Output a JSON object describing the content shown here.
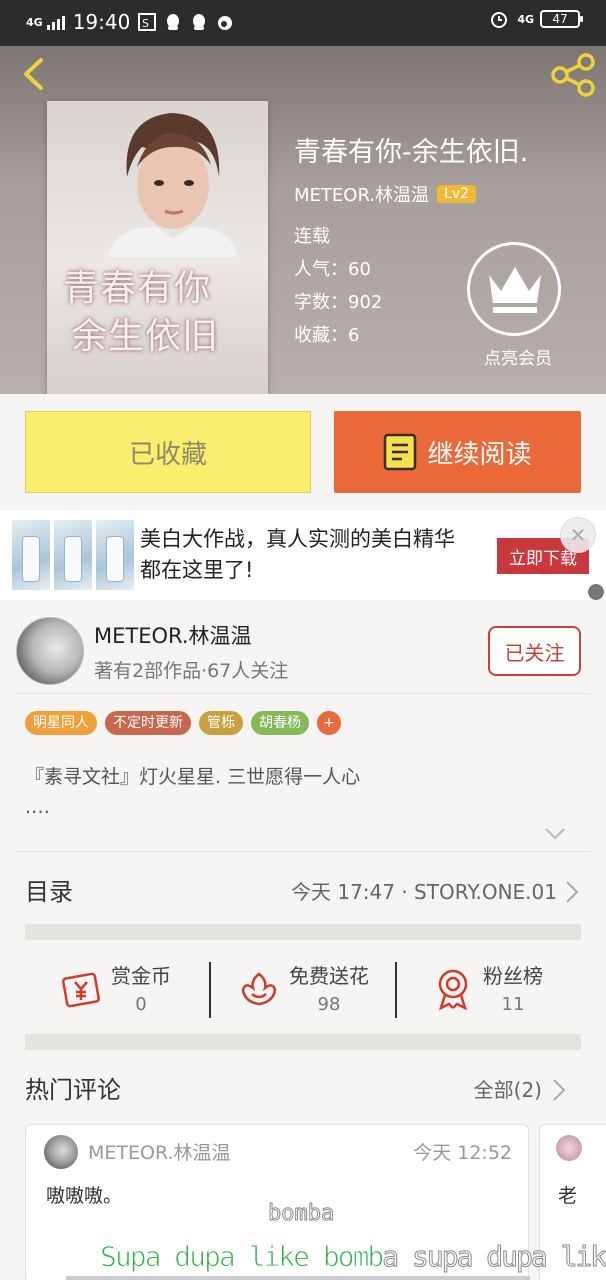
{
  "status_bar": {
    "network": "4G",
    "time": "19:40",
    "right_network": "4G",
    "battery": "47"
  },
  "book": {
    "title": "青春有你-余生依旧.",
    "author": "METEOR.林温温",
    "level": "Lv2",
    "status": "连载",
    "popularity": "人气：60",
    "word_count": "字数：902",
    "favorites": "收藏：6",
    "cover_title_line1": "青春有你",
    "cover_title_line2": "余生依旧",
    "membership_label": "点亮会员"
  },
  "actions": {
    "collected_label": "已收藏",
    "continue_label": "继续阅读"
  },
  "ad": {
    "text": "美白大作战，真人实测的美白精华都在这里了!",
    "button": "立即下载"
  },
  "author_card": {
    "name": "METEOR.林温温",
    "subtitle": "著有2部作品·67人关注",
    "follow_label": "已关注",
    "tags": [
      {
        "label": "明星同人",
        "color": "#f0a03a"
      },
      {
        "label": "不定时更新",
        "color": "#c8664e"
      },
      {
        "label": "管栎",
        "color": "#c9a03e"
      },
      {
        "label": "胡春杨",
        "color": "#86b85a"
      }
    ],
    "tag_plus": "+",
    "intro_line1": "『素寻文社』灯火星星. 三世愿得一人心",
    "intro_line2": ".…"
  },
  "toc": {
    "label": "目录",
    "latest": "今天 17:47 · STORY.ONE.01"
  },
  "stats": [
    {
      "label": "赏金币",
      "value": "0",
      "icon": "reward-coin-icon"
    },
    {
      "label": "免费送花",
      "value": "98",
      "icon": "flower-icon"
    },
    {
      "label": "粉丝榜",
      "value": "11",
      "icon": "medal-icon"
    }
  ],
  "hot_comments": {
    "label": "热门评论",
    "all_label": "全部(2)",
    "comments": [
      {
        "name": "METEOR.林温温",
        "time": "今天 12:52",
        "text": "嗷嗷嗷。"
      },
      {
        "text": "老"
      }
    ]
  },
  "overlay": {
    "lyric_1": "bomba",
    "lyric_2_highlight": "Supa dupa like bomb",
    "lyric_2_rest": "a supa dupa like"
  },
  "colors": {
    "accent": "#e9693a",
    "collected_bg": "#faee6e",
    "follow": "#c84037",
    "level_badge": "#f2b733"
  }
}
